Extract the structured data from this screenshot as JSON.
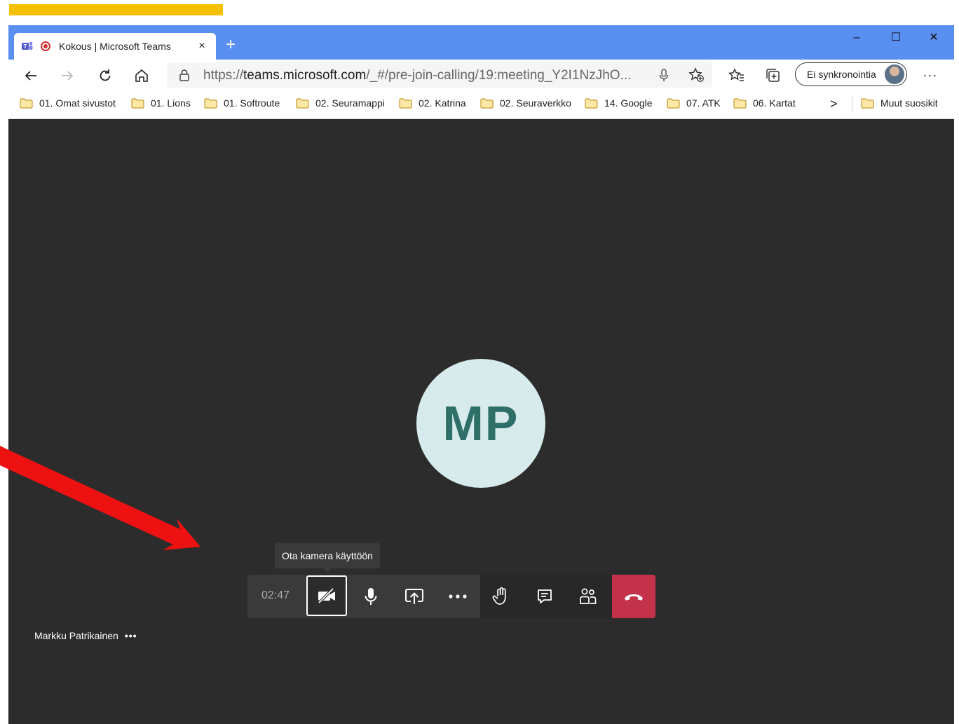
{
  "browser": {
    "tab": {
      "title": "Kokous | Microsoft Teams",
      "close": "×"
    },
    "new_tab": "+",
    "window_controls": {
      "minimize": "–",
      "maximize": "☐",
      "close": "✕"
    },
    "address": {
      "url_prefix": "https://",
      "url_domain": "teams.microsoft.com",
      "url_rest": "/_#/pre-join-calling/19:meeting_Y2I1NzJhO..."
    },
    "sync_label": "Ei synkronointia",
    "more": "···",
    "bookmarks": [
      "01. Omat sivustot",
      "01. Lions",
      "01. Softroute",
      "02. Seuramappi",
      "02. Katrina",
      "02. Seuraverkko",
      "14. Google",
      "07. ATK",
      "06. Kartat"
    ],
    "bookmarks_chevron": ">",
    "other_bookmarks": "Muut suosikit"
  },
  "meeting": {
    "avatar_initials": "MP",
    "tooltip": "Ota kamera käyttöön",
    "timer": "02:47",
    "participant_name": "Markku Patrikainen",
    "participant_more": "•••",
    "colors": {
      "hangup": "#c4314b",
      "avatar_bg": "#d8ebec",
      "avatar_text": "#2e6f67",
      "stage": "#2d2c2d",
      "titlebar": "#5a8ff2",
      "annotation_arrow": "#ee1111",
      "highlight_bar": "#f5c000"
    }
  },
  "icons": [
    "teams-icon",
    "recording-icon",
    "back-arrow-icon",
    "forward-arrow-icon",
    "refresh-icon",
    "home-icon",
    "lock-icon",
    "microphone-icon",
    "add-favorite-icon",
    "favorites-icon",
    "collections-icon",
    "folder-icon",
    "camera-off-icon",
    "mic-icon",
    "share-screen-icon",
    "more-actions-icon",
    "raise-hand-icon",
    "chat-icon",
    "participants-icon",
    "hang-up-icon"
  ]
}
